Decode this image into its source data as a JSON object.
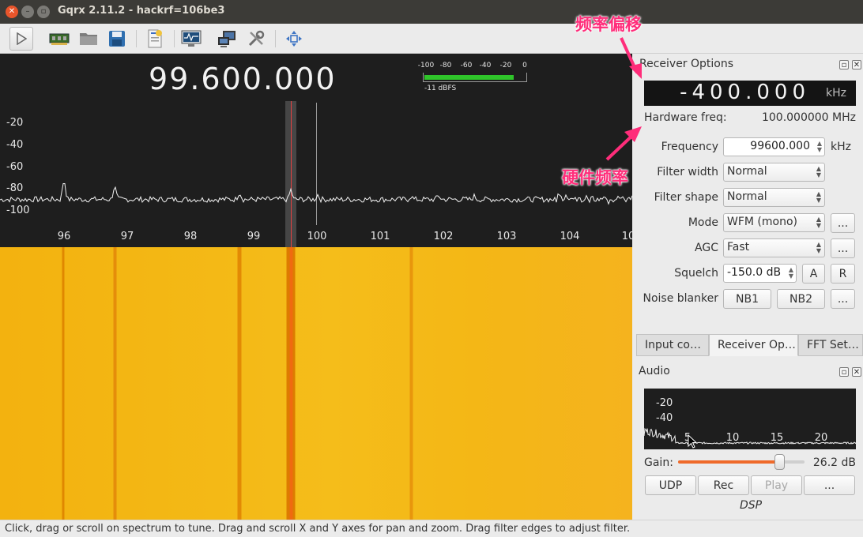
{
  "window": {
    "title": "Gqrx 2.11.2 - hackrf=106be3"
  },
  "colors": {
    "accent": "#ef6a2a",
    "annotation": "#ff2d7a",
    "signal_meter": "#2fc42a",
    "tuning_marker": "#e34040"
  },
  "toolbar": {
    "icons": [
      "play-icon",
      "hardware-icon",
      "open-folder-icon",
      "save-icon",
      "document-icon",
      "monitor-icon",
      "network-icon",
      "settings-tools-icon",
      "move-arrows-icon"
    ]
  },
  "spectrum": {
    "frequency_display": "99.600.000",
    "smeter": {
      "ticks": [
        "-100",
        "-80",
        "-60",
        "-40",
        "-20",
        "0"
      ],
      "level_label": "-11 dBFS"
    },
    "y_labels": [
      "-20",
      "-40",
      "-60",
      "-80",
      "-100"
    ],
    "x_labels": [
      "96",
      "97",
      "98",
      "99",
      "100",
      "101",
      "102",
      "103",
      "104",
      "10"
    ]
  },
  "receiver_options": {
    "title": "Receiver Options",
    "offset_value": "-400.000",
    "offset_unit": "kHz",
    "hardware_freq_label": "Hardware freq:",
    "hardware_freq_value": "100.000000 MHz",
    "frequency_label": "Frequency",
    "frequency_value": "99600.000",
    "frequency_unit": "kHz",
    "filter_width_label": "Filter width",
    "filter_width_value": "Normal",
    "filter_shape_label": "Filter shape",
    "filter_shape_value": "Normal",
    "mode_label": "Mode",
    "mode_value": "WFM (mono)",
    "mode_more": "...",
    "agc_label": "AGC",
    "agc_value": "Fast",
    "agc_more": "...",
    "squelch_label": "Squelch",
    "squelch_value": "-150.0 dB",
    "squelch_a": "A",
    "squelch_r": "R",
    "noise_blanker_label": "Noise blanker",
    "nb1": "NB1",
    "nb2": "NB2",
    "nb_more": "..."
  },
  "tabs": [
    "Input co…",
    "Receiver Op…",
    "FFT Set…"
  ],
  "audio": {
    "title": "Audio",
    "y_labels": [
      "-20",
      "-40"
    ],
    "x_labels": [
      "5",
      "10",
      "15",
      "20"
    ],
    "gain_label": "Gain:",
    "gain_value": "26.2 dB",
    "gain_level": 0.8,
    "udp": "UDP",
    "rec": "Rec",
    "play": "Play",
    "more": "...",
    "dsp_label": "DSP"
  },
  "status_bar": "Click, drag or scroll on spectrum to tune. Drag and scroll X and Y axes for pan and zoom. Drag filter edges to adjust filter.",
  "annotations": {
    "offset": "频率偏移",
    "hardware": "硬件频率"
  }
}
